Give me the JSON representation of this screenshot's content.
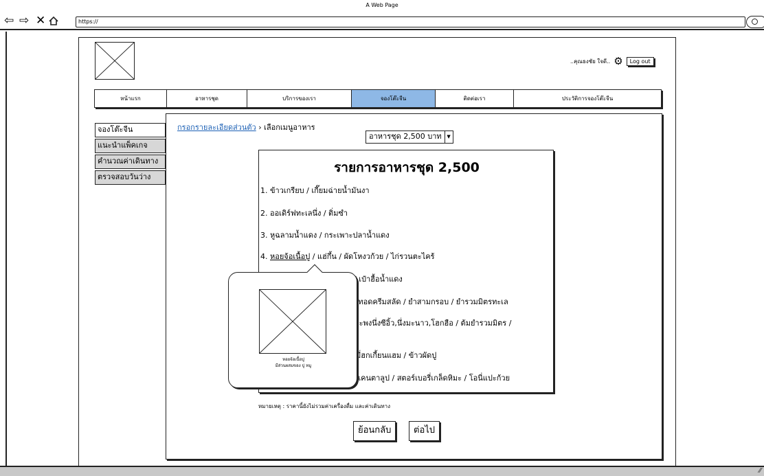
{
  "window": {
    "title": "A Web Page"
  },
  "browser": {
    "url": "https://",
    "nav_icons": [
      "back-arrow-icon",
      "forward-arrow-icon",
      "close-x-icon",
      "home-icon"
    ]
  },
  "header": {
    "user_greeting": "..คุณธงชัย ใจดี..",
    "logout_label": "Log out"
  },
  "nav": {
    "tabs": [
      {
        "label": "หน้าแรก"
      },
      {
        "label": "อาหารชุด"
      },
      {
        "label": "บริการของเรา"
      },
      {
        "label": "จองโต๊ะจีน",
        "active": true
      },
      {
        "label": "ติดต่อเรา"
      },
      {
        "label": "ประวัติการจองโต๊ะจีน"
      }
    ]
  },
  "sidebar": {
    "items": [
      {
        "label": "จองโต๊ะจีน",
        "active": true
      },
      {
        "label": "แนะนำแพ็คเกจ"
      },
      {
        "label": "คำนวณค่าเดินทาง"
      },
      {
        "label": "ตรวจสอบวันว่าง"
      }
    ]
  },
  "breadcrumb": {
    "link": "กรอกรายละเอียดส่วนตัว",
    "separator": " › ",
    "current": "เลือกเมนูอาหาร"
  },
  "package_select": {
    "value": "อาหารชุด 2,500 บาท"
  },
  "menu": {
    "title": "รายการอาหารชุด 2,500",
    "items": [
      {
        "text": "1. ข้าวเกรียบ / เกี๊ยมฉ่ายน้ำมันงา"
      },
      {
        "text": "2. ออเดิร์ฟทะเลนึ่ง / ติ่มซำ"
      },
      {
        "text": "3. หูฉลามน้ำแดง / กระเพาะปลาน้ำแดง"
      },
      {
        "prefix": "4. ",
        "link": "หอยจ้อเนื้อปู",
        "text": " / แฮ่กึ้น / ผัดโหงวก้วย / ไก่รวนตะไคร้"
      },
      {
        "text": "/ เป๋าฮื้อน้ำแดง"
      },
      {
        "text": "งทอดครีมสลัด / ยำสามกรอบ / ยำรวมมิตรทะเล"
      },
      {
        "text": "กะพงนึ่งซีอิ้ว,นึ่งมะนาว,โฮกฮือ / ต้มยำรวมมิตร /"
      },
      {
        "text": "มี่ฮกเกี้ยนแฮม / ข้าวผัดปู"
      },
      {
        "text": "แคนตาลูป / สตอร์เบอรี่เกล็ดหิมะ / โอนี่แปะก้วย"
      }
    ]
  },
  "popup": {
    "caption_line1": "หอยจ้อเนื้อปู",
    "caption_line2": "มีส่วนผสมของ ปู หมู"
  },
  "note": "หมายเหตุ : ราคานี้ยังไม่รวมค่าเครื่องดื่ม และค่าเดินทาง",
  "buttons": {
    "back": "ย้อนกลับ",
    "next": "ต่อไป"
  }
}
